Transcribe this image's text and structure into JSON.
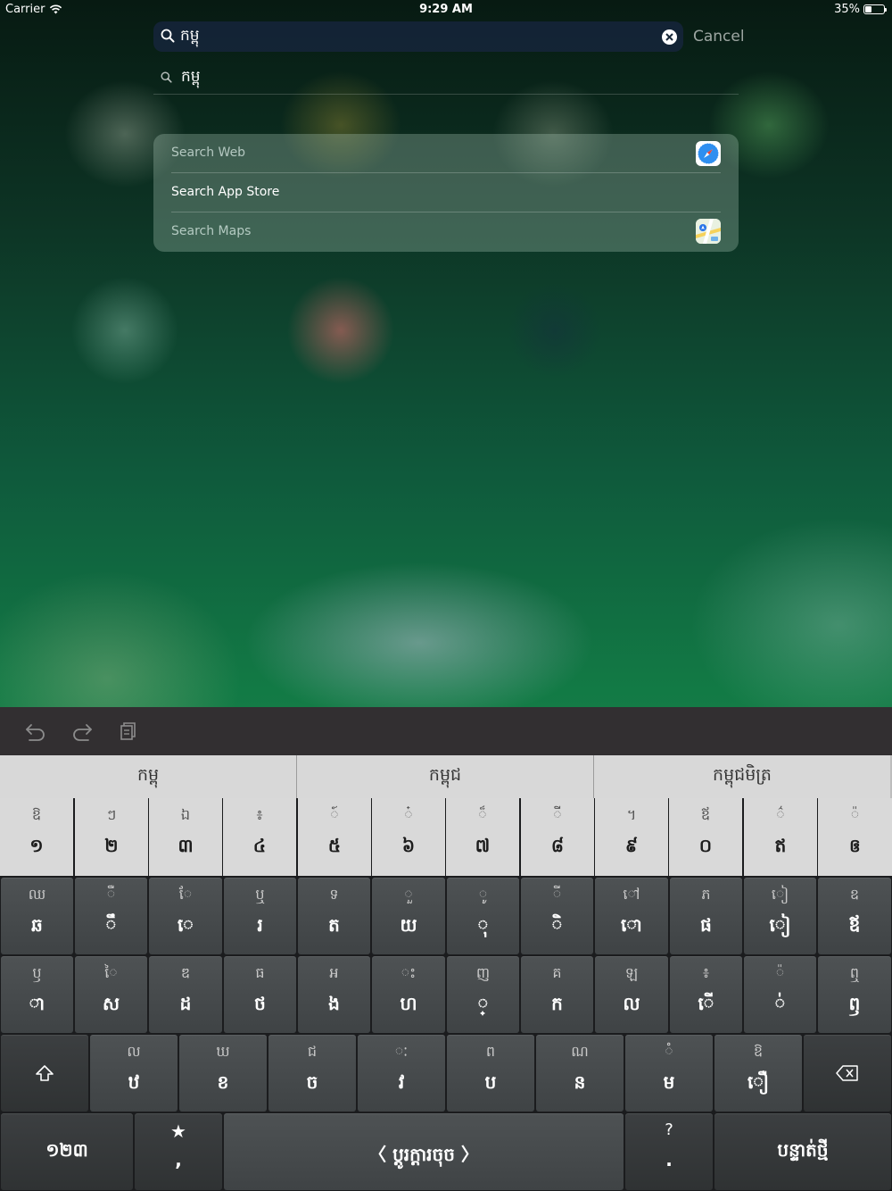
{
  "status_bar": {
    "carrier": "Carrier",
    "time": "9:29 AM",
    "battery": "35%",
    "battery_fraction": 0.35
  },
  "search": {
    "query": "កម្ពុ",
    "cancel_label": "Cancel",
    "suggestion": "កម្ពុ"
  },
  "results": [
    {
      "label": "Search Web",
      "icon": "safari-icon"
    },
    {
      "label": "Search App Store",
      "icon": ""
    },
    {
      "label": "Search Maps",
      "icon": "maps-icon"
    }
  ],
  "toolbar": {
    "undo": "undo-icon",
    "redo": "redo-icon",
    "paste": "paste-icon"
  },
  "predictions": [
    "កម្ពុ",
    "កម្ពុជ",
    "កម្ពុជមិត្រ"
  ],
  "keyboard": {
    "number_row": [
      {
        "sec": "ឱ",
        "pri": "១"
      },
      {
        "sec": "ៗ",
        "pri": "២"
      },
      {
        "sec": "ឯ",
        "pri": "៣"
      },
      {
        "sec": "៖",
        "pri": "៤"
      },
      {
        "sec": "៍",
        "pri": "៥"
      },
      {
        "sec": "៎",
        "pri": "៦"
      },
      {
        "sec": "៏",
        "pri": "៧"
      },
      {
        "sec": "ី",
        "pri": "៨"
      },
      {
        "sec": "។",
        "pri": "៩"
      },
      {
        "sec": "ឪ",
        "pri": "០"
      },
      {
        "sec": "៌",
        "pri": "ឥ"
      },
      {
        "sec": "៉",
        "pri": "ឲ"
      }
    ],
    "row1": [
      {
        "sec": "ឈ",
        "pri": "ឆ"
      },
      {
        "sec": "ឺ",
        "pri": "ឹ"
      },
      {
        "sec": "ែ",
        "pri": "េ"
      },
      {
        "sec": "ឬ",
        "pri": "រ"
      },
      {
        "sec": "ទ",
        "pri": "ត"
      },
      {
        "sec": "ួ",
        "pri": "យ"
      },
      {
        "sec": "ូ",
        "pri": "ុ"
      },
      {
        "sec": "ី",
        "pri": "ិ"
      },
      {
        "sec": "ៅ",
        "pri": "ោ"
      },
      {
        "sec": "ភ",
        "pri": "ផ"
      },
      {
        "sec": "ៀ",
        "pri": "ៀ"
      },
      {
        "sec": "ឧ",
        "pri": "ឪ"
      }
    ],
    "row2": [
      {
        "sec": "ឫ",
        "pri": "ា"
      },
      {
        "sec": "ៃ",
        "pri": "ស"
      },
      {
        "sec": "ឌ",
        "pri": "ដ"
      },
      {
        "sec": "ធ",
        "pri": "ថ"
      },
      {
        "sec": "អ",
        "pri": "ង"
      },
      {
        "sec": "ះ",
        "pri": "ហ"
      },
      {
        "sec": "ញ",
        "pri": "្"
      },
      {
        "sec": "គ",
        "pri": "ក"
      },
      {
        "sec": "ឡ",
        "pri": "ល"
      },
      {
        "sec": "៖",
        "pri": "ើ"
      },
      {
        "sec": "៉",
        "pri": "់"
      },
      {
        "sec": "ឮ",
        "pri": "ឭ"
      }
    ],
    "row3": [
      {
        "sec": "ល",
        "pri": "ឋ"
      },
      {
        "sec": "ឃ",
        "pri": "ខ"
      },
      {
        "sec": "ជ",
        "pri": "ច"
      },
      {
        "sec": "ៈ",
        "pri": "វ"
      },
      {
        "sec": "ព",
        "pri": "ប"
      },
      {
        "sec": "ណ",
        "pri": "ន"
      },
      {
        "sec": "ំ",
        "pri": "ម"
      },
      {
        "sec": "ឱ",
        "pri": "ឿ"
      }
    ],
    "numbers_key": "១២៣",
    "comma_key": {
      "sec": "★",
      "pri": ","
    },
    "space_key": "〈 ប្ដូរក្ដារចុច 〉",
    "period_key": {
      "sec": "?",
      "pri": "."
    },
    "return_key": "បន្ទាត់ថ្មី",
    "shift_icon": "shift-icon",
    "delete_icon": "delete-icon"
  }
}
